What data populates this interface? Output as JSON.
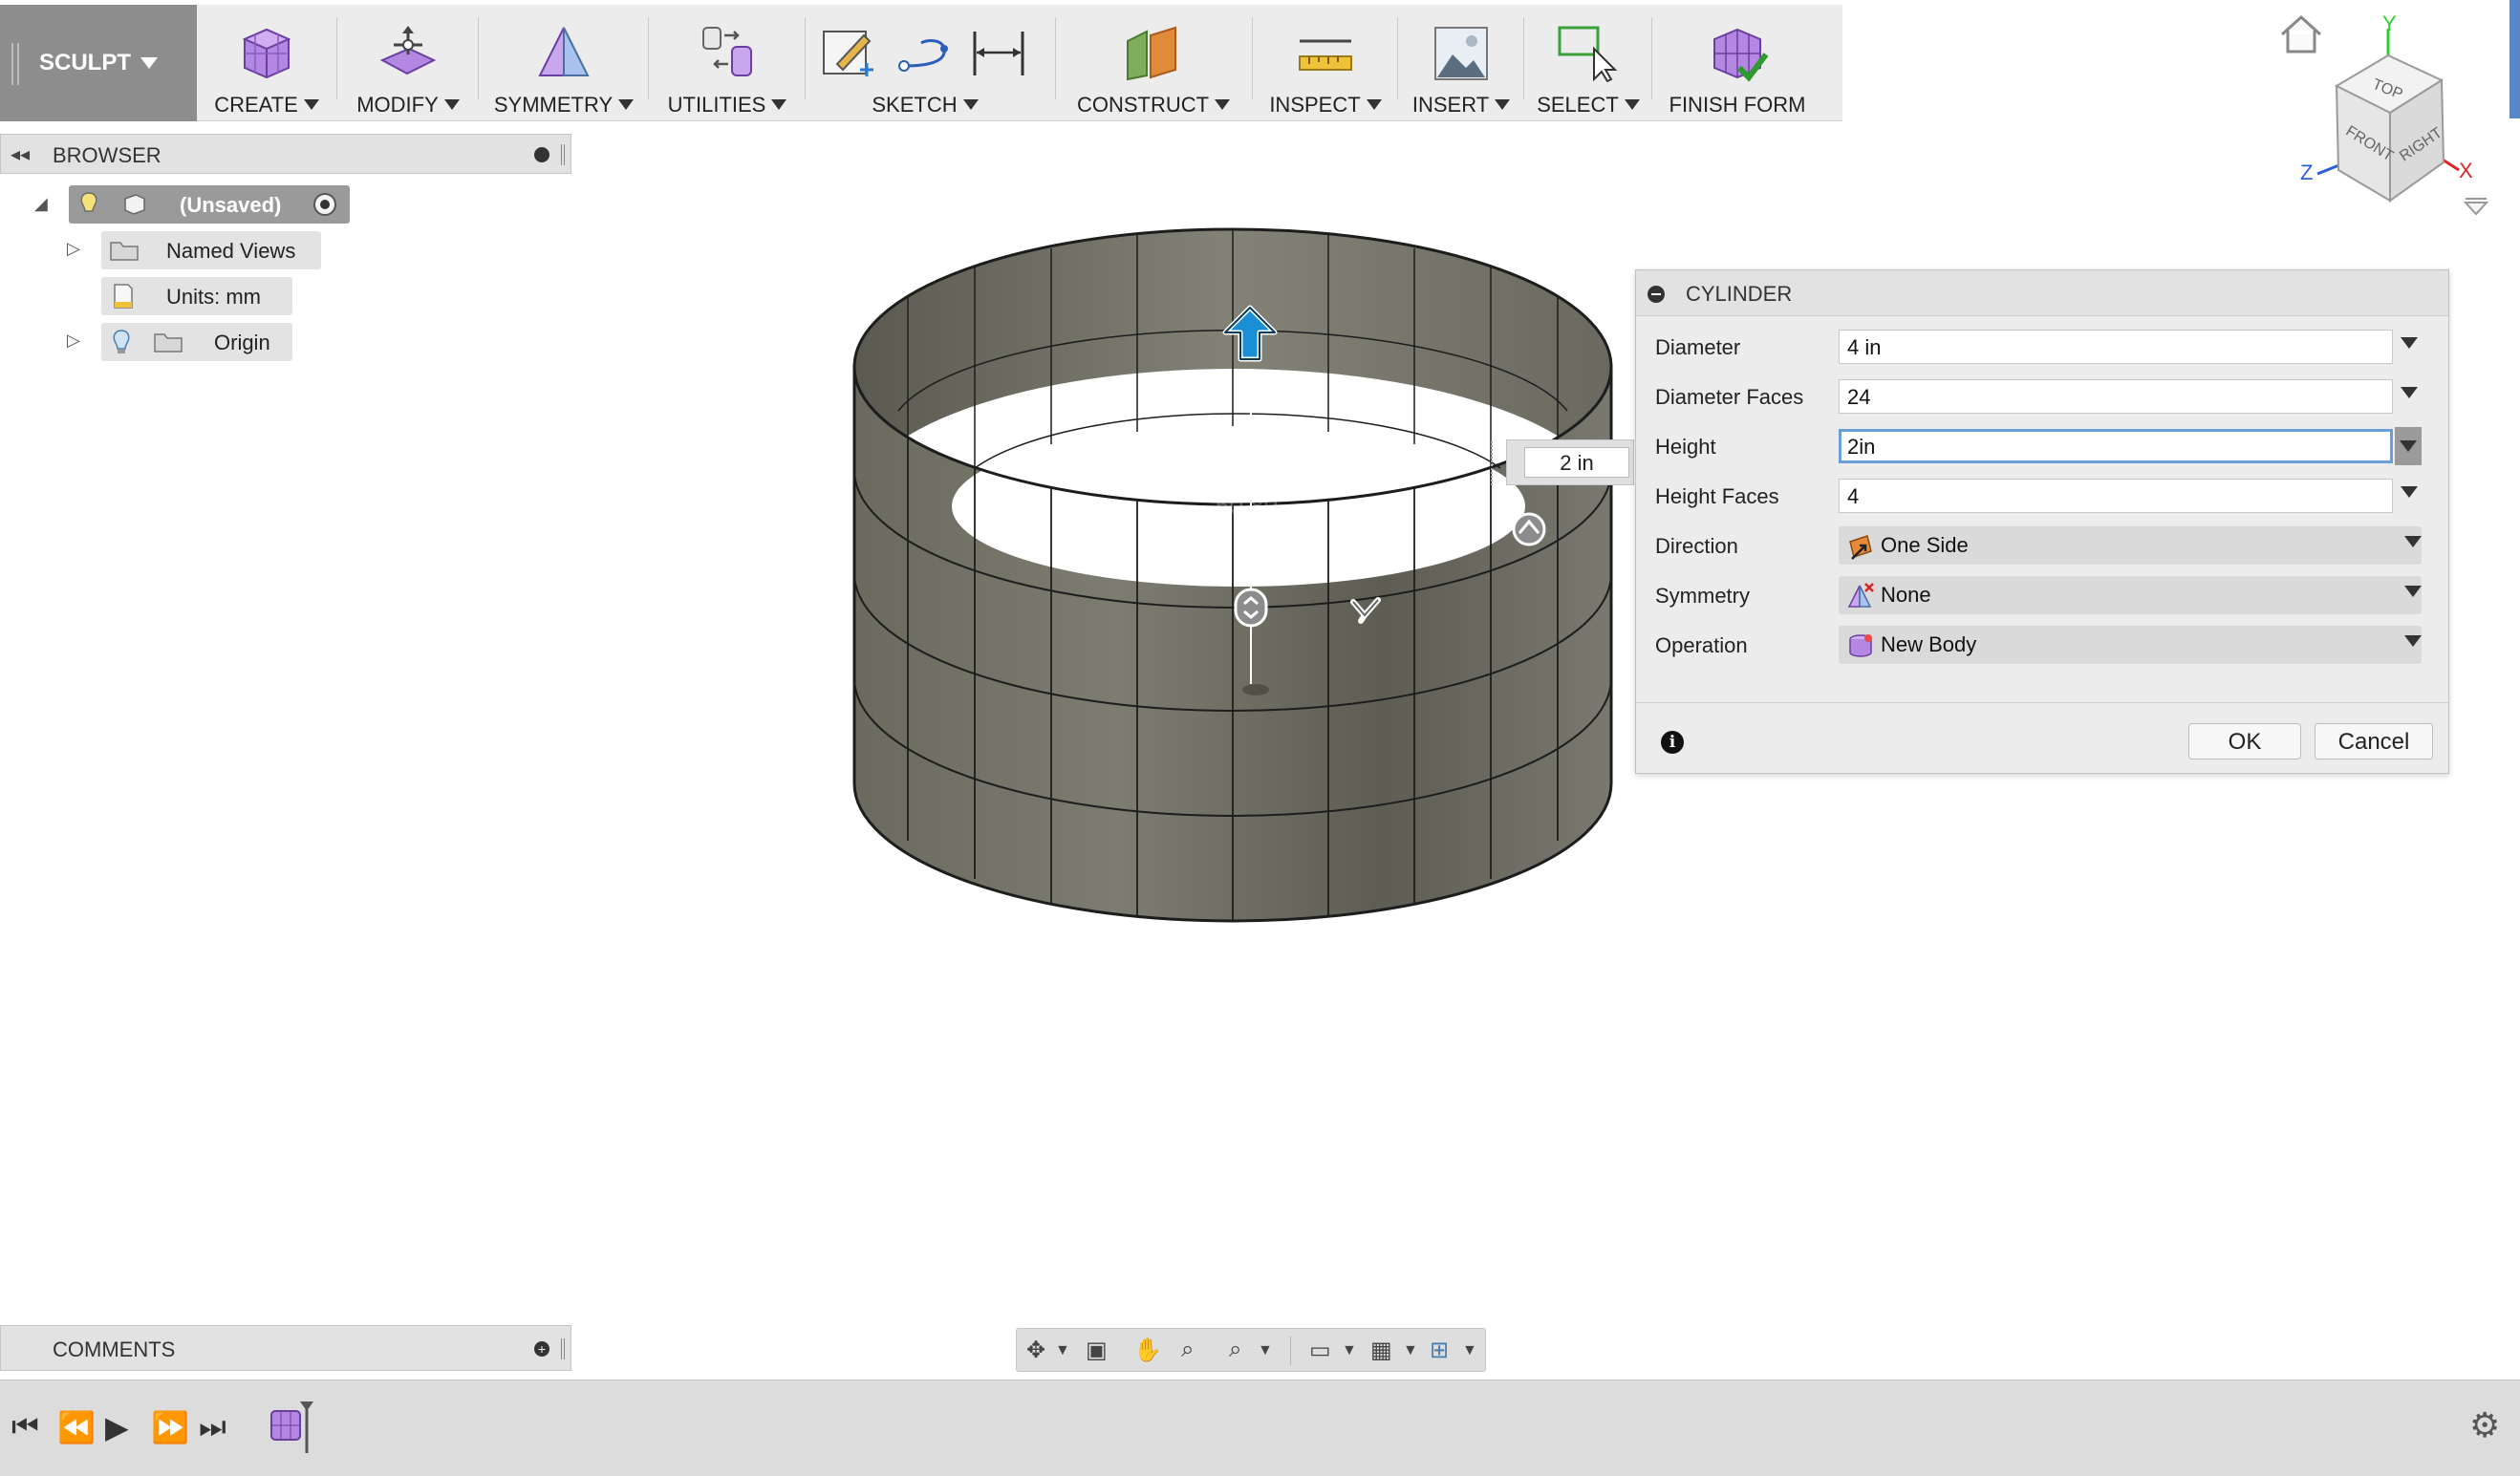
{
  "toolbar": {
    "workspace": "SCULPT",
    "groups": [
      {
        "label": "CREATE"
      },
      {
        "label": "MODIFY"
      },
      {
        "label": "SYMMETRY"
      },
      {
        "label": "UTILITIES"
      },
      {
        "label": "SKETCH"
      },
      {
        "label": "CONSTRUCT"
      },
      {
        "label": "INSPECT"
      },
      {
        "label": "INSERT"
      },
      {
        "label": "SELECT"
      },
      {
        "label": "FINISH FORM"
      }
    ]
  },
  "browser": {
    "title": "BROWSER",
    "items": [
      {
        "label": "(Unsaved)"
      },
      {
        "label": "Named Views"
      },
      {
        "label": "Units: mm"
      },
      {
        "label": "Origin"
      }
    ]
  },
  "comments": {
    "title": "COMMENTS"
  },
  "viewport": {
    "height_label": "2 in",
    "faint_value": "50.80"
  },
  "viewcube": {
    "top": "TOP",
    "front": "FRONT",
    "right": "RIGHT",
    "x": "X",
    "y": "Y",
    "z": "Z"
  },
  "dialog": {
    "title": "CYLINDER",
    "rows": [
      {
        "label": "Diameter",
        "value": "4 in"
      },
      {
        "label": "Diameter Faces",
        "value": "24"
      },
      {
        "label": "Height",
        "value": "2in"
      },
      {
        "label": "Height Faces",
        "value": "4"
      },
      {
        "label": "Direction",
        "value": "One Side"
      },
      {
        "label": "Symmetry",
        "value": "None"
      },
      {
        "label": "Operation",
        "value": "New Body"
      }
    ],
    "ok": "OK",
    "cancel": "Cancel"
  },
  "colors": {
    "selected_tree": "#9a9a9a",
    "focus_border": "#6a9fd8",
    "manipulator": "#1a8fd6"
  }
}
